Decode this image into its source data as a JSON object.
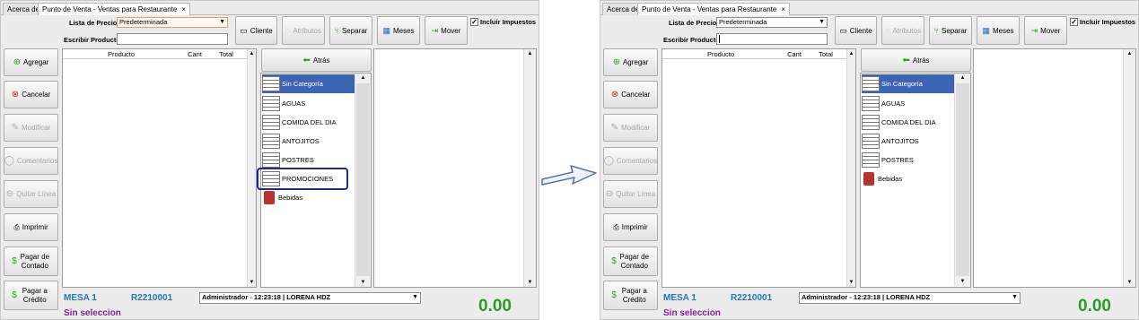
{
  "arrow_icon": "right-arrow-icon",
  "panels": [
    {
      "tabs": [
        "Acerca de",
        "Punto de Venta - Ventas para Restaurante"
      ],
      "tab_close": "×",
      "lista_precios_label": "Lista de Precios",
      "lista_precios_value": "Predeterminada",
      "escribir_producto_label": "Escribir Producto",
      "escribir_producto_value": "",
      "toolbar": {
        "cliente": "Cliente",
        "atributos": "Atributos",
        "separar": "Separar",
        "meses": "Meses",
        "mover": "Mover"
      },
      "incluir_impuestos_label": "Incluir Impuestos",
      "incluir_impuestos_checked": true,
      "side_buttons": [
        "Agregar",
        "Cancelar",
        "Modificar",
        "Comentarios",
        "Quitar Línea",
        "Imprimir",
        "Pagar de Contado",
        "Pagar a Crédito"
      ],
      "grid_columns": [
        "Producto",
        "Cant",
        "Total"
      ],
      "atras_label": "Atrás",
      "categories": [
        "Sin Categoría",
        "AGUAS",
        "COMIDA DEL DIA",
        "ANTOJITOS",
        "POSTRES",
        "PROMOCIONES",
        "Bebidas"
      ],
      "selected_category": "Sin Categoría",
      "highlighted_category": "PROMOCIONES",
      "mesa": "MESA 1",
      "folio": "R2210001",
      "usuario": "Administrador - 12:23:18 | LORENA HDZ",
      "sin_seleccion": "Sin seleccion",
      "total": "0.00"
    },
    {
      "tabs": [
        "Acerca de",
        "Punto de Venta - Ventas para Restaurante"
      ],
      "tab_close": "×",
      "lista_precios_label": "Lista de Precios",
      "lista_precios_value": "Predeterminada",
      "escribir_producto_label": "Escribir Producto",
      "escribir_producto_value": "",
      "toolbar": {
        "cliente": "Cliente",
        "atributos": "Atributos",
        "separar": "Separar",
        "meses": "Meses",
        "mover": "Mover"
      },
      "incluir_impuestos_label": "Incluir Impuestos",
      "incluir_impuestos_checked": true,
      "side_buttons": [
        "Agregar",
        "Cancelar",
        "Modificar",
        "Comentarios",
        "Quitar Línea",
        "Imprimir",
        "Pagar de Contado",
        "Pagar a Crédito"
      ],
      "grid_columns": [
        "Producto",
        "Cant",
        "Total"
      ],
      "atras_label": "Atrás",
      "categories": [
        "Sin Categoría",
        "AGUAS",
        "COMIDA DEL DIA",
        "ANTOJITOS",
        "POSTRES",
        "Bebidas"
      ],
      "selected_category": "Sin Categoría",
      "mesa": "MESA 1",
      "folio": "R2210001",
      "usuario": "Administrador - 12:23:18 | LORENA HDZ",
      "sin_seleccion": "Sin seleccion",
      "total": "0.00"
    }
  ]
}
